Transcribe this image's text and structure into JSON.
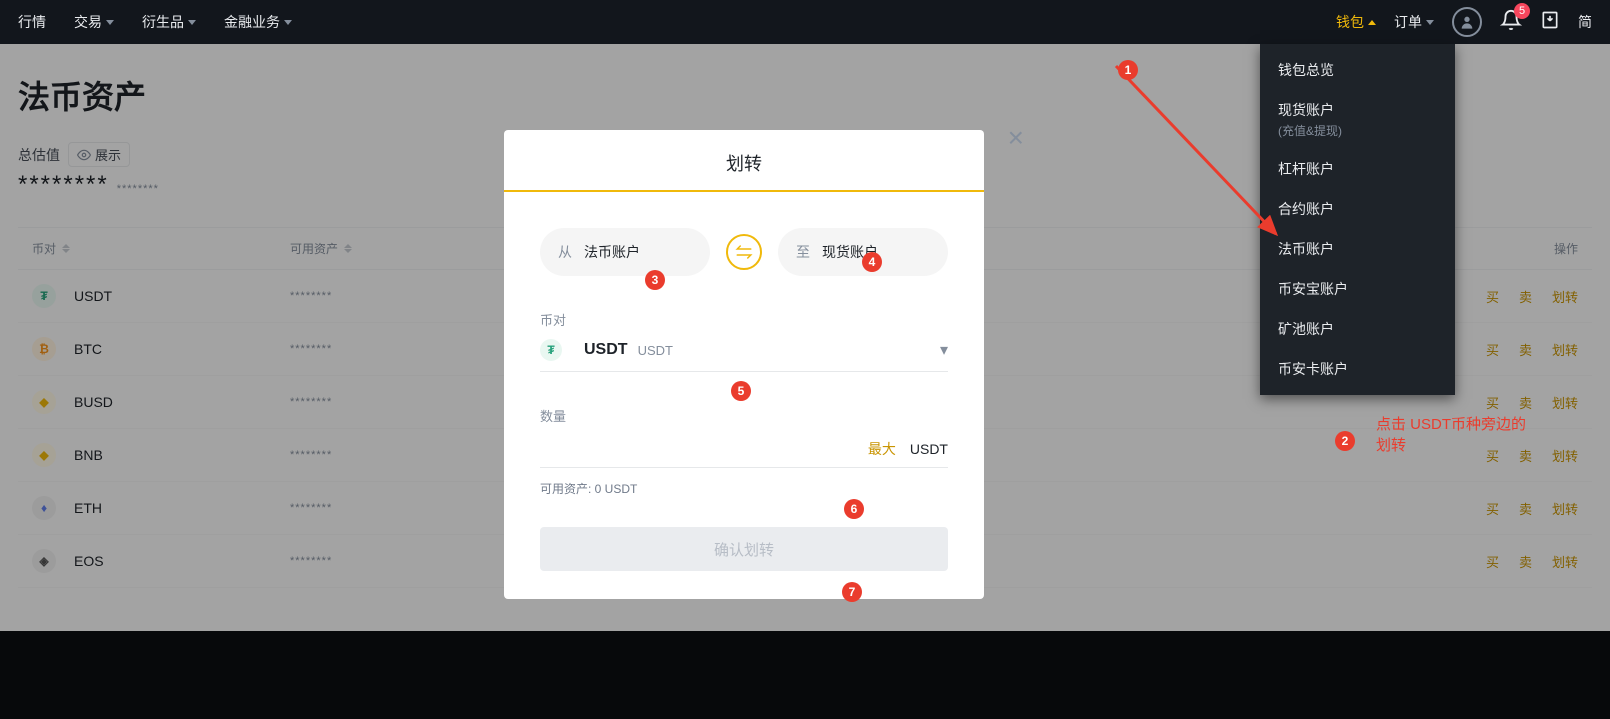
{
  "nav": {
    "left": [
      "行情",
      "交易",
      "衍生品",
      "金融业务"
    ],
    "wallet": "钱包",
    "orders": "订单",
    "lastItem": "简",
    "badge": "5"
  },
  "walletMenu": {
    "items": [
      {
        "label": "钱包总览",
        "sub": ""
      },
      {
        "label": "现货账户",
        "sub": "(充值&提现)"
      },
      {
        "label": "杠杆账户",
        "sub": ""
      },
      {
        "label": "合约账户",
        "sub": ""
      },
      {
        "label": "法币账户",
        "sub": ""
      },
      {
        "label": "币安宝账户",
        "sub": ""
      },
      {
        "label": "矿池账户",
        "sub": ""
      },
      {
        "label": "币安卡账户",
        "sub": ""
      }
    ]
  },
  "page": {
    "title": "法币资产",
    "estLabel": "总估值",
    "showLabel": "展示",
    "estValue": "********",
    "estSub": "********"
  },
  "table": {
    "headers": {
      "coin": "币对",
      "avail": "可用资产",
      "action": "操作"
    },
    "actions": {
      "buy": "买",
      "sell": "卖",
      "transfer": "划转"
    },
    "rows": [
      {
        "sym": "USDT",
        "avail": "********",
        "iconBg": "#e9f7f1",
        "iconFg": "#26a17b",
        "glyph": "₮"
      },
      {
        "sym": "BTC",
        "avail": "********",
        "iconBg": "#fff3e0",
        "iconFg": "#f7931a",
        "glyph": "₿"
      },
      {
        "sym": "BUSD",
        "avail": "********",
        "iconBg": "#fff9e6",
        "iconFg": "#f0b90b",
        "glyph": "◆"
      },
      {
        "sym": "BNB",
        "avail": "********",
        "iconBg": "#fff9e6",
        "iconFg": "#f0b90b",
        "glyph": "◆"
      },
      {
        "sym": "ETH",
        "avail": "********",
        "iconBg": "#f0f0f0",
        "iconFg": "#627eea",
        "glyph": "♦"
      },
      {
        "sym": "EOS",
        "avail": "********",
        "iconBg": "#f0f0f0",
        "iconFg": "#555",
        "glyph": "◈"
      }
    ]
  },
  "modal": {
    "title": "划转",
    "fromLabel": "从",
    "fromValue": "法币账户",
    "toLabel": "至",
    "toValue": "现货账户",
    "coinLabel": "币对",
    "coinSym": "USDT",
    "coinFull": "USDT",
    "amountLabel": "数量",
    "maxLabel": "最大",
    "amountUnit": "USDT",
    "availableText": "可用资产: 0 USDT",
    "confirm": "确认划转"
  },
  "anno": {
    "b1": "1",
    "b2": "2",
    "b3": "3",
    "b4": "4",
    "b5": "5",
    "b6": "6",
    "b7": "7",
    "text": "点击 USDT币种旁边的划转"
  }
}
